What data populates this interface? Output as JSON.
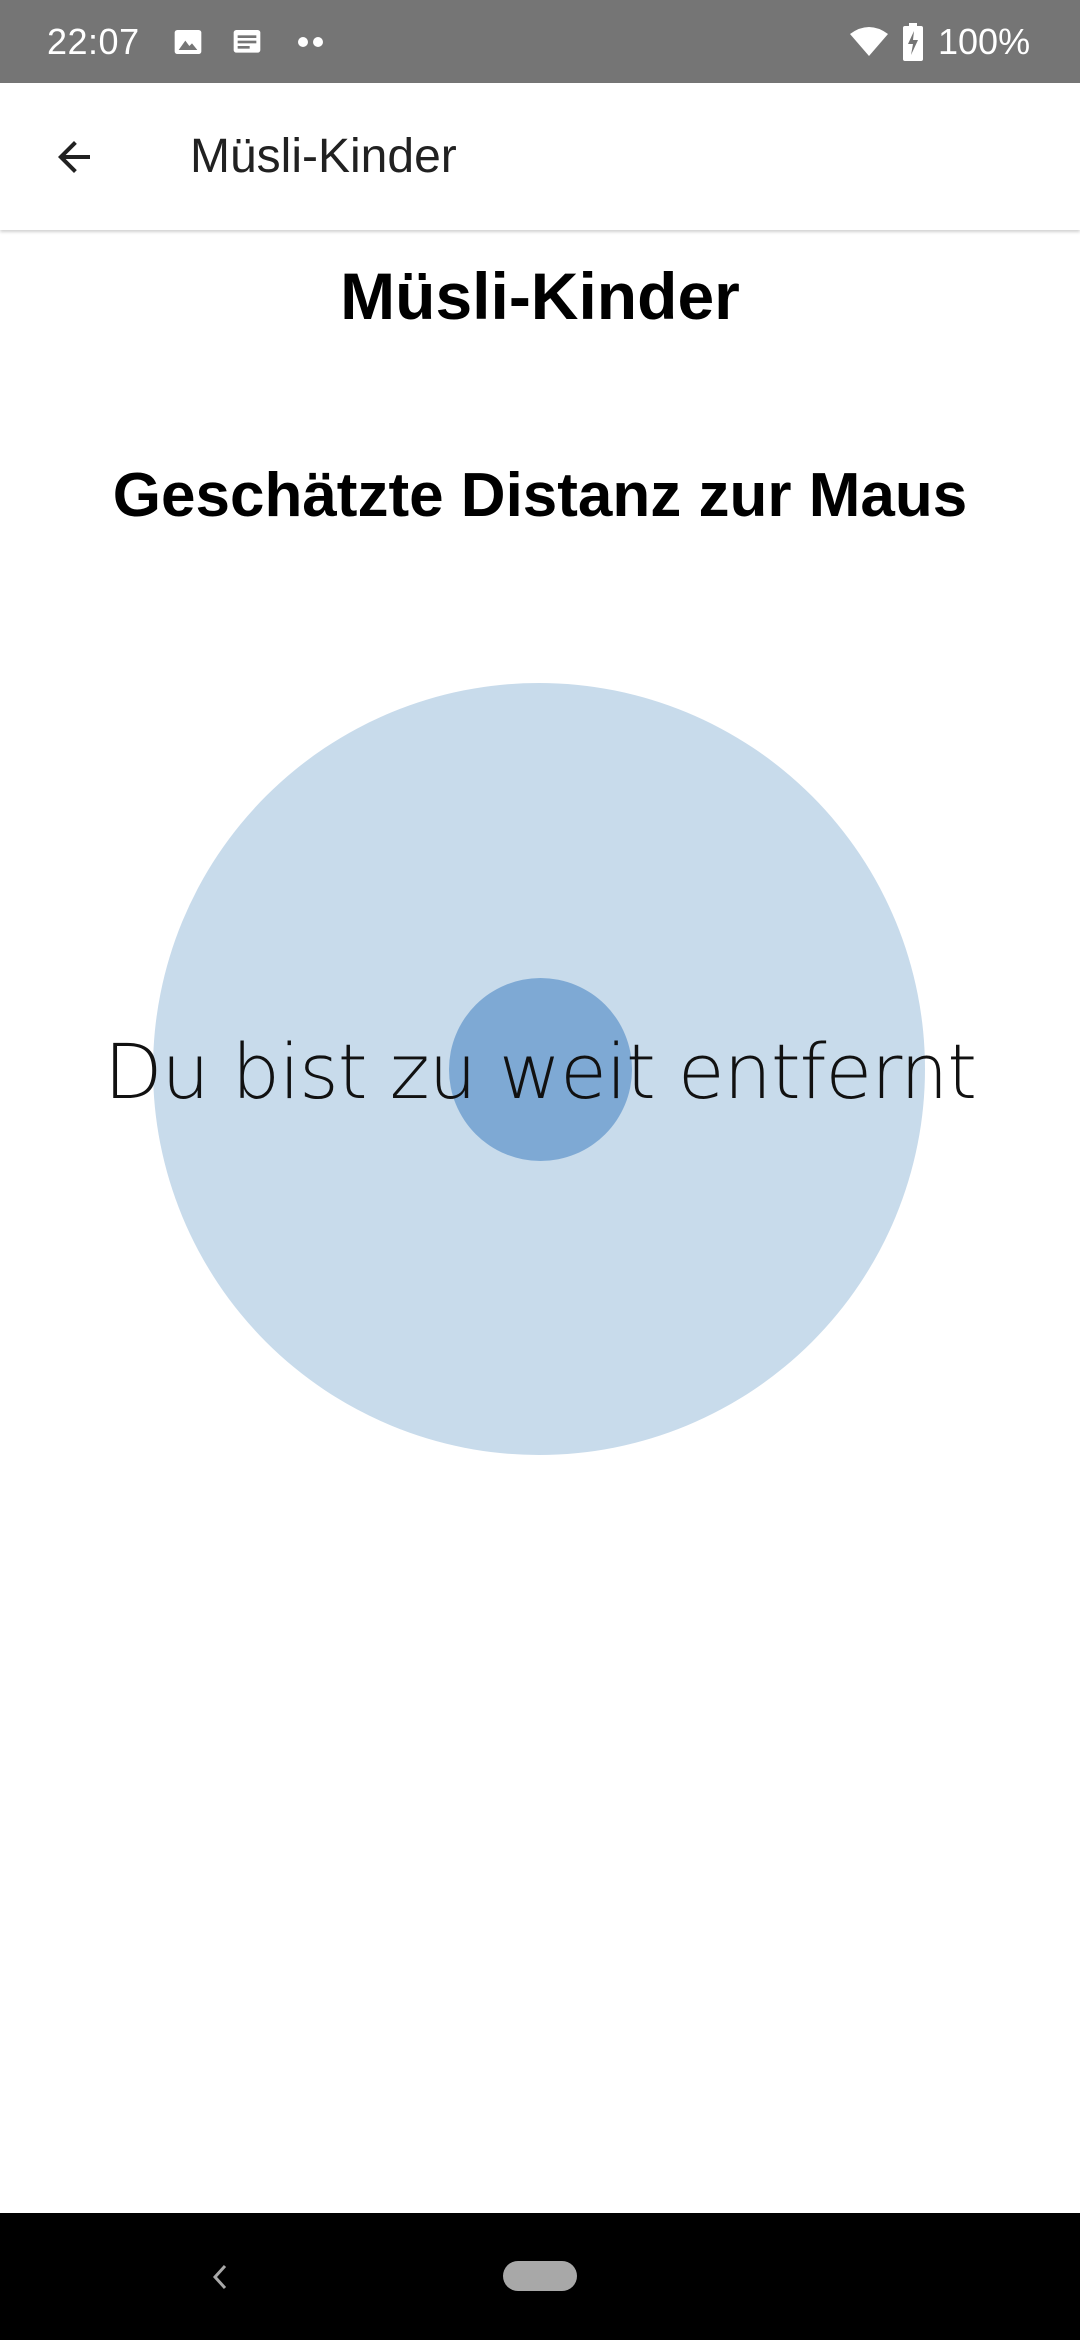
{
  "status_bar": {
    "time": "22:07",
    "battery": "100%",
    "icons": [
      "image-icon",
      "message-icon",
      "more-dots-icon",
      "wifi-icon",
      "battery-charging-icon"
    ]
  },
  "app_bar": {
    "title": "Müsli-Kinder",
    "back_icon": "arrow-left-icon"
  },
  "content": {
    "title": "Müsli-Kinder",
    "subtitle": "Geschätzte Distanz zur Maus",
    "distance_message": "Du bist zu weit entfernt"
  },
  "colors": {
    "status_bar": "#757575",
    "radar_outer": "#c8dbeb",
    "radar_inner": "#7ea9d4",
    "nav_bar": "#000000"
  },
  "nav_bar": {
    "icons": [
      "nav-back-icon",
      "nav-home-pill"
    ]
  }
}
